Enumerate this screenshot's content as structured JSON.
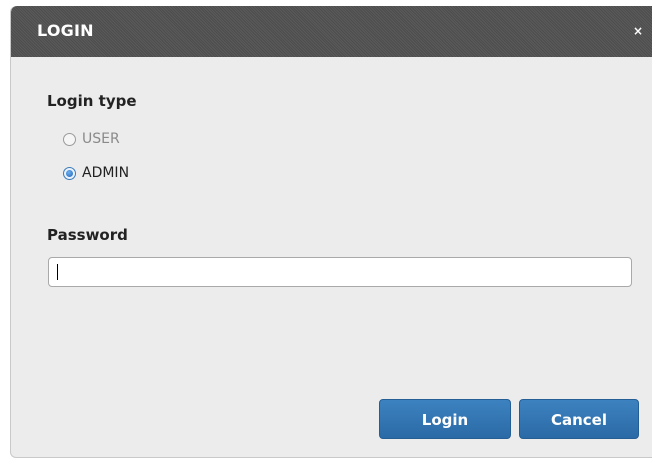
{
  "dialog": {
    "title": "LOGIN",
    "close_label": "×"
  },
  "login_type": {
    "label": "Login type",
    "options": [
      {
        "label": "USER",
        "selected": false,
        "enabled": false
      },
      {
        "label": "ADMIN",
        "selected": true,
        "enabled": true
      }
    ]
  },
  "password": {
    "label": "Password",
    "value": "",
    "placeholder": ""
  },
  "buttons": {
    "login_label": "Login",
    "cancel_label": "Cancel"
  },
  "colors": {
    "titlebar": "#4d4d4d",
    "dialog_background": "#ececec",
    "button_primary": "#2f72b0",
    "radio_selected": "#1f64b8"
  }
}
